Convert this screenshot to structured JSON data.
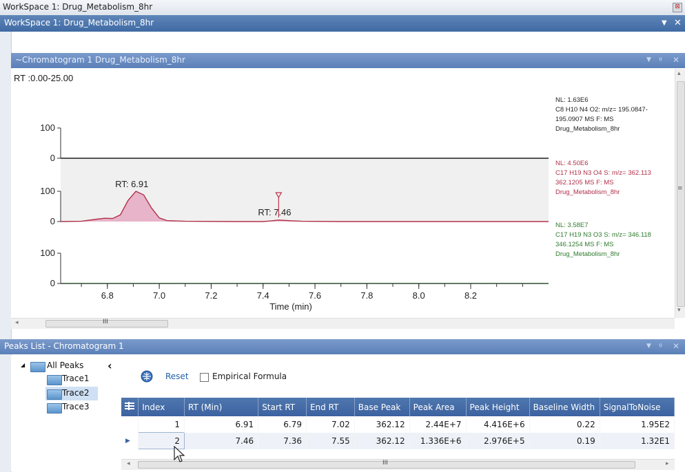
{
  "window": {
    "title": "WorkSpace 1: Drug_Metabolism_8hr",
    "close_glyph": "⊠"
  },
  "workspace_panel": {
    "title": "WorkSpace 1: Drug_Metabolism_8hr",
    "dropdown_glyph": "▼",
    "close_glyph": "✕"
  },
  "chromatogram_panel": {
    "title": "~Chromatogram  1  Drug_Metabolism_8hr",
    "dropdown_glyph": "▼",
    "pin_glyph": "ᵍ",
    "close_glyph": "✕"
  },
  "chart_data": {
    "type": "line",
    "range_label": "RT :0.00-25.00",
    "xlabel": "Time (min)",
    "xlim": [
      6.62,
      8.5
    ],
    "x_ticks": [
      "6.8",
      "7.0",
      "7.2",
      "7.4",
      "7.6",
      "7.8",
      "8.0",
      "8.2"
    ],
    "y_tick_labels": [
      "100",
      "0"
    ],
    "peak_labels": [
      "RT: 6.91",
      "RT: 7.46"
    ],
    "panels": [
      {
        "name": "",
        "color": "#1f1f1f",
        "legend": [
          "NL: 1.63E6",
          "C8 H10 N4 O2: m/z= 195.0847-",
          "195.0907 MS  F: MS",
          "Drug_Metabolism_8hr"
        ],
        "x": [
          6.62,
          8.5
        ],
        "y": [
          0,
          0
        ]
      },
      {
        "name": "",
        "color": "#b0304a",
        "legend": [
          "NL: 4.50E6",
          "C17 H19 N3 O4 S: m/z= 362.113",
          "362.1205 MS  F: MS",
          "Drug_Metabolism_8hr"
        ],
        "x": [
          6.62,
          6.7,
          6.76,
          6.79,
          6.82,
          6.85,
          6.88,
          6.91,
          6.94,
          6.97,
          7.0,
          7.03,
          7.1,
          7.3,
          7.4,
          7.43,
          7.46,
          7.5,
          7.55,
          7.7,
          8.5
        ],
        "y": [
          0,
          1,
          8,
          11,
          10,
          22,
          70,
          100,
          88,
          45,
          12,
          3,
          1,
          0,
          0,
          2,
          5,
          3,
          1,
          0,
          0
        ]
      },
      {
        "name": "",
        "color": "#2e7a2e",
        "legend": [
          "NL: 3.58E7",
          "C17 H19 N3 O3 S: m/z= 346.118",
          "346.1254 MS  F: MS",
          "Drug_Metabolism_8hr"
        ],
        "x": [
          6.62,
          8.5
        ],
        "y": [
          0,
          0
        ]
      }
    ]
  },
  "peaks_panel": {
    "title": "Peaks List   - Chromatogram 1",
    "dropdown_glyph": "▼",
    "pin_glyph": "ᵍ",
    "close_glyph": "✕"
  },
  "tree": {
    "collapse_glyph": "◢",
    "root": "All Peaks",
    "back_glyph": "‹",
    "items": [
      "Trace1",
      "Trace2",
      "Trace3"
    ],
    "selected": "Trace2"
  },
  "toolbar": {
    "reset_label": "Reset",
    "empirical_label": "Empirical Formula",
    "empirical_checked": false
  },
  "table": {
    "columns": [
      "Index",
      "RT (Min)",
      "Start RT",
      "End RT",
      "Base Peak",
      "Peak Area",
      "Peak Height",
      "Baseline Width",
      "SignalToNoise"
    ],
    "rows": [
      [
        "1",
        "6.91",
        "6.79",
        "7.02",
        "362.12",
        "2.44E+7",
        "4.416E+6",
        "0.22",
        "1.95E2"
      ],
      [
        "2",
        "7.46",
        "7.36",
        "7.55",
        "362.12",
        "1.336E+6",
        "2.976E+5",
        "0.19",
        "1.32E1"
      ]
    ],
    "current_row_glyph": "▶"
  },
  "scroll": {
    "left": "◂",
    "right": "▸",
    "up": "▴",
    "down": "▾",
    "grip": "III",
    "side_grip": "≡"
  }
}
